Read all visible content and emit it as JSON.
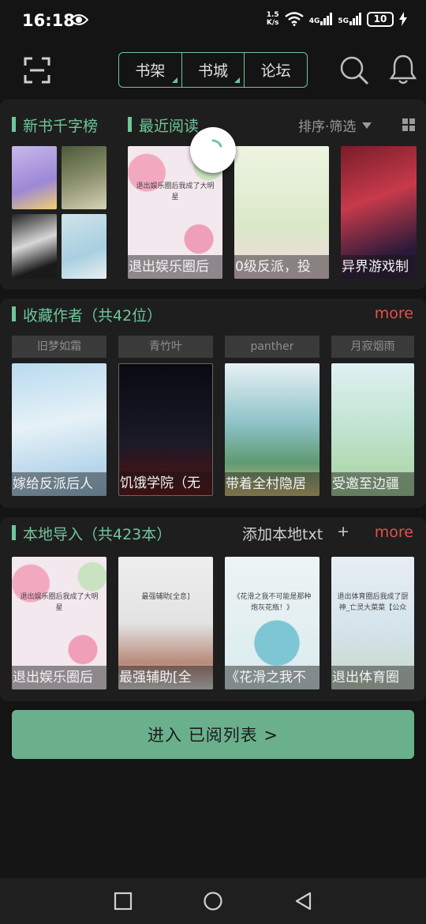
{
  "status_bar": {
    "time": "16:18",
    "net_speed_value": "1.5",
    "net_speed_unit": "K/s",
    "net1": "4G",
    "net2": "5G",
    "battery": "10"
  },
  "header": {
    "tabs": [
      {
        "label": "书架"
      },
      {
        "label": "书城"
      },
      {
        "label": "论坛"
      }
    ],
    "accent_color": "#6fc79a"
  },
  "top_section": {
    "rank_title": "新书千字榜",
    "recent_title": "最近阅读",
    "sort_filter": "排序·筛选",
    "recent_books": [
      {
        "title": "退出娱乐圈后",
        "inner": "退出娱乐圈后我成了大明星"
      },
      {
        "title": "0级反派，投"
      },
      {
        "title": "异界游戏制"
      }
    ]
  },
  "authors_section": {
    "title": "收藏作者（共42位）",
    "more": "more",
    "authors": [
      {
        "name": "旧梦如霜",
        "book": "嫁给反派后人"
      },
      {
        "name": "青竹叶",
        "book": "饥饿学院（无"
      },
      {
        "name": "panther",
        "book": "带着全村隐居"
      },
      {
        "name": "月寂烟雨",
        "book": "受邀至边疆"
      }
    ]
  },
  "local_section": {
    "title": "本地导入（共423本）",
    "add_label": "添加本地txt",
    "add_plus": "+",
    "more": "more",
    "books": [
      {
        "title": "退出娱乐圈后",
        "inner": "退出娱乐圈后我成了大明星"
      },
      {
        "title": "最强辅助[全",
        "inner": "最强辅助[全息]"
      },
      {
        "title": "《花滑之我不",
        "inner": "《花滑之我不可能是那种炮灰花瓶！》"
      },
      {
        "title": "退出体育圈",
        "inner": "退出体育圈后我成了厨神_亡灵大菜菜【公众"
      }
    ]
  },
  "enter_button": "进入 已阅列表 >"
}
